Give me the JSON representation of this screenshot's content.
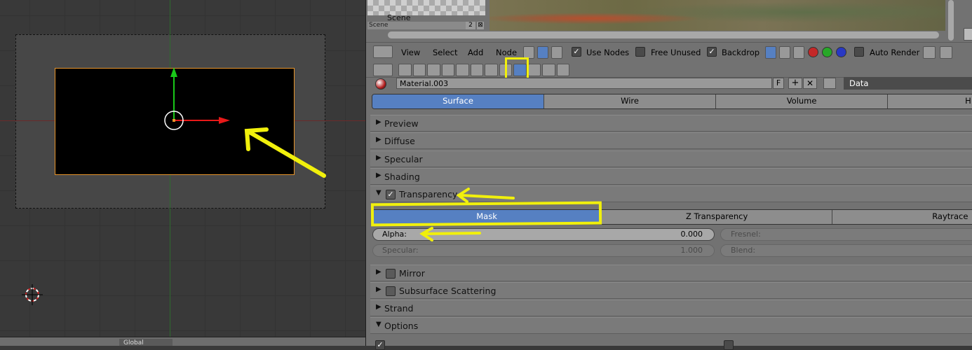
{
  "outliner": {
    "scene_label": "Scene",
    "scene_field": "Scene",
    "scene_users": "2",
    "scene_close": "⊠"
  },
  "node_header": {
    "menus": [
      "View",
      "Select",
      "Add",
      "Node"
    ],
    "use_nodes_label": "Use Nodes",
    "free_unused_label": "Free Unused",
    "backdrop_label": "Backdrop",
    "auto_render_label": "Auto Render"
  },
  "material": {
    "name": "Material.003",
    "fake_user": "F",
    "data_label": "Data"
  },
  "tabs": [
    "Surface",
    "Wire",
    "Volume",
    "H"
  ],
  "panels": {
    "preview": "Preview",
    "diffuse": "Diffuse",
    "specular": "Specular",
    "shading": "Shading",
    "transparency": "Transparency",
    "mirror": "Mirror",
    "sss": "Subsurface Scattering",
    "strand": "Strand",
    "options": "Options"
  },
  "transparency": {
    "modes": [
      "Mask",
      "Z Transparency",
      "Raytrace"
    ],
    "alpha_label": "Alpha:",
    "alpha_value": "0.000",
    "specular_label": "Specular:",
    "specular_value": "1.000",
    "fresnel_label": "Fresnel:",
    "blend_label": "Blend:"
  },
  "viewport_footer": {
    "orientation": "Global"
  },
  "colors": {
    "selection_blue": "#5680c2",
    "annotation_yellow": "#f1f00c",
    "object_outline": "#e8952b",
    "x_axis": "#e81919",
    "y_axis": "#19c819"
  },
  "icons": [
    "material-icon",
    "render-icon",
    "scene-icon",
    "world-icon",
    "object-icon",
    "constraints-icon",
    "modifiers-icon",
    "data-icon",
    "texture-icon",
    "particles-icon",
    "physics-icon",
    "checker-icon",
    "sphere-icon",
    "add-icon",
    "close-icon",
    "browse-icon",
    "pin-icon",
    "cursor-icon"
  ]
}
